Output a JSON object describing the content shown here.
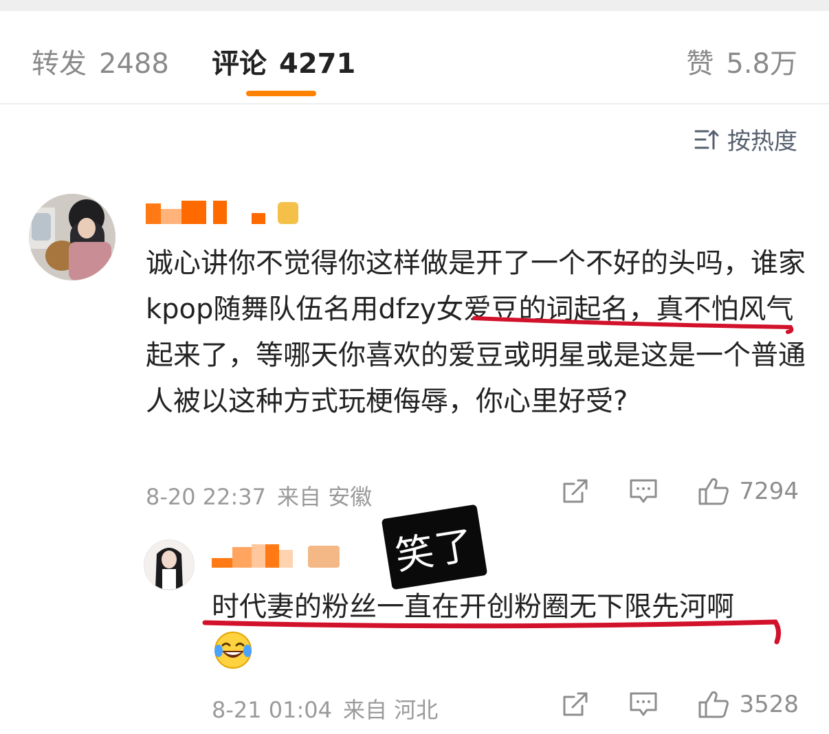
{
  "tabs": [
    {
      "label": "转发",
      "count": "2488"
    },
    {
      "label": "评论",
      "count": "4271"
    },
    {
      "label": "赞",
      "count": "5.8万"
    }
  ],
  "sort": {
    "label": "按热度",
    "icon": "sort-icon"
  },
  "comment": {
    "text": "诚心讲你不觉得你这样做是开了一个不好的头吗，谁家kpop随舞队伍名用dfzy女爱豆的词起名，真不怕风气起来了，等哪天你喜欢的爱豆或明星或是这是一个普通人被以这种方式玩梗侮辱，你心里好受?",
    "date": "8-20 22:37",
    "source": "来自 安徽",
    "likes": "7294"
  },
  "reply": {
    "text": "时代妻的粉丝一直在开创粉圈无下限先河啊",
    "emoji": "laughing-crying-emoji",
    "date": "8-21 01:04",
    "source": "来自 河北",
    "likes": "3528"
  },
  "sticker": {
    "text": "笑了"
  },
  "colors": {
    "accent": "#ff8200",
    "annotation": "#d2112b",
    "pixelate": "#ff6d00"
  }
}
